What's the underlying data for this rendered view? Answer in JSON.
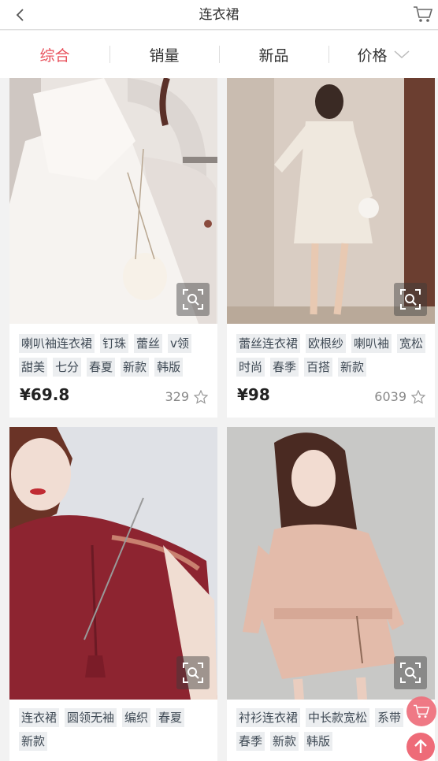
{
  "header": {
    "title": "连衣裙",
    "back_icon": "chevron-left-icon",
    "cart_icon": "cart-icon"
  },
  "tabs": [
    {
      "label": "综合",
      "active": true
    },
    {
      "label": "销量",
      "active": false
    },
    {
      "label": "新品",
      "active": false
    },
    {
      "label": "价格",
      "active": false,
      "icon": "chevron-down-icon"
    }
  ],
  "products": [
    {
      "tags": [
        "喇叭袖连衣裙",
        "钉珠",
        "蕾丝",
        "v领",
        "甜美",
        "七分",
        "春夏",
        "新款",
        "韩版"
      ],
      "price": "¥69.8",
      "sales": "329"
    },
    {
      "tags": [
        "蕾丝连衣裙",
        "欧根纱",
        "喇叭袖",
        "宽松",
        "时尚",
        "春季",
        "百搭",
        "新款"
      ],
      "price": "¥98",
      "sales": "6039"
    },
    {
      "tags": [
        "连衣裙",
        "圆领无袖",
        "编织",
        "春夏",
        "新款"
      ]
    },
    {
      "tags": [
        "衬衫连衣裙",
        "中长款宽松",
        "系带",
        "春季",
        "新款",
        "韩版"
      ]
    }
  ],
  "colors": {
    "accent": "#e8505b",
    "fab": "#ee6b78"
  }
}
